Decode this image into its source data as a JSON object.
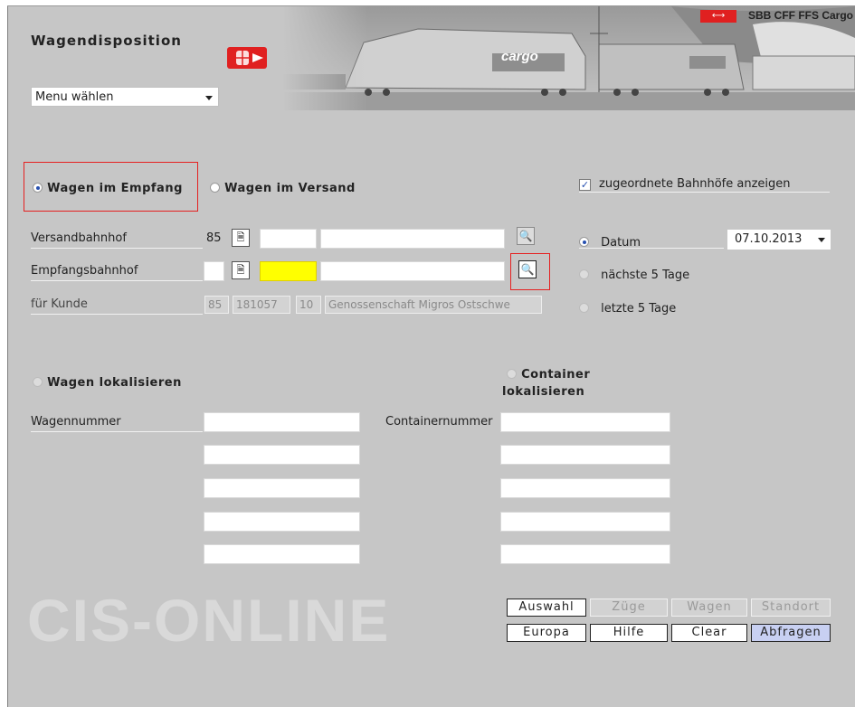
{
  "app": {
    "title": "Wagendisposition",
    "brand": "SBB CFF FFS Cargo",
    "brand_flag": "⟷",
    "watermark": "CIS-ONLINE",
    "banner_cargo_text": "cargo"
  },
  "menu": {
    "selected": "Menu wählen"
  },
  "mode": {
    "receive_label": "Wagen im Empfang",
    "dispatch_label": "Wagen im Versand",
    "receive_checked": true
  },
  "options": {
    "show_assigned_stations_label": "zugeordnete Bahnhöfe anzeigen",
    "show_assigned_stations_checked": true
  },
  "form": {
    "versand_label": "Versandbahnhof",
    "versand_country": "85",
    "empfang_label": "Empfangsbahnhof",
    "kunde_label": "für Kunde",
    "kunde_country": "85",
    "kunde_number": "181057",
    "kunde_suffix": "10",
    "kunde_name": "Genossenschaft Migros Ostschwe"
  },
  "date_options": {
    "datum_label": "Datum",
    "datum_value": "07.10.2013",
    "next5_label": "nächste 5 Tage",
    "last5_label": "letzte 5 Tage"
  },
  "locate": {
    "wagen_label": "Wagen lokalisieren",
    "container_label": "Container lokalisieren",
    "wagennummer_label": "Wagennummer",
    "containernummer_label": "Containernummer"
  },
  "buttons": {
    "auswahl": "Auswahl",
    "zuege": "Züge",
    "wagen": "Wagen",
    "standort": "Standort",
    "europa": "Europa",
    "hilfe": "Hilfe",
    "clear": "Clear",
    "abfragen": "Abfragen"
  },
  "icons": {
    "document": "document-icon",
    "magnifier": "magnifier-icon",
    "logo": "train-logo-icon"
  },
  "colors": {
    "background": "#c6c6c6",
    "highlight_red": "#e52020",
    "yellow_field": "#ffff00",
    "primary_button": "#c8d0f2"
  }
}
